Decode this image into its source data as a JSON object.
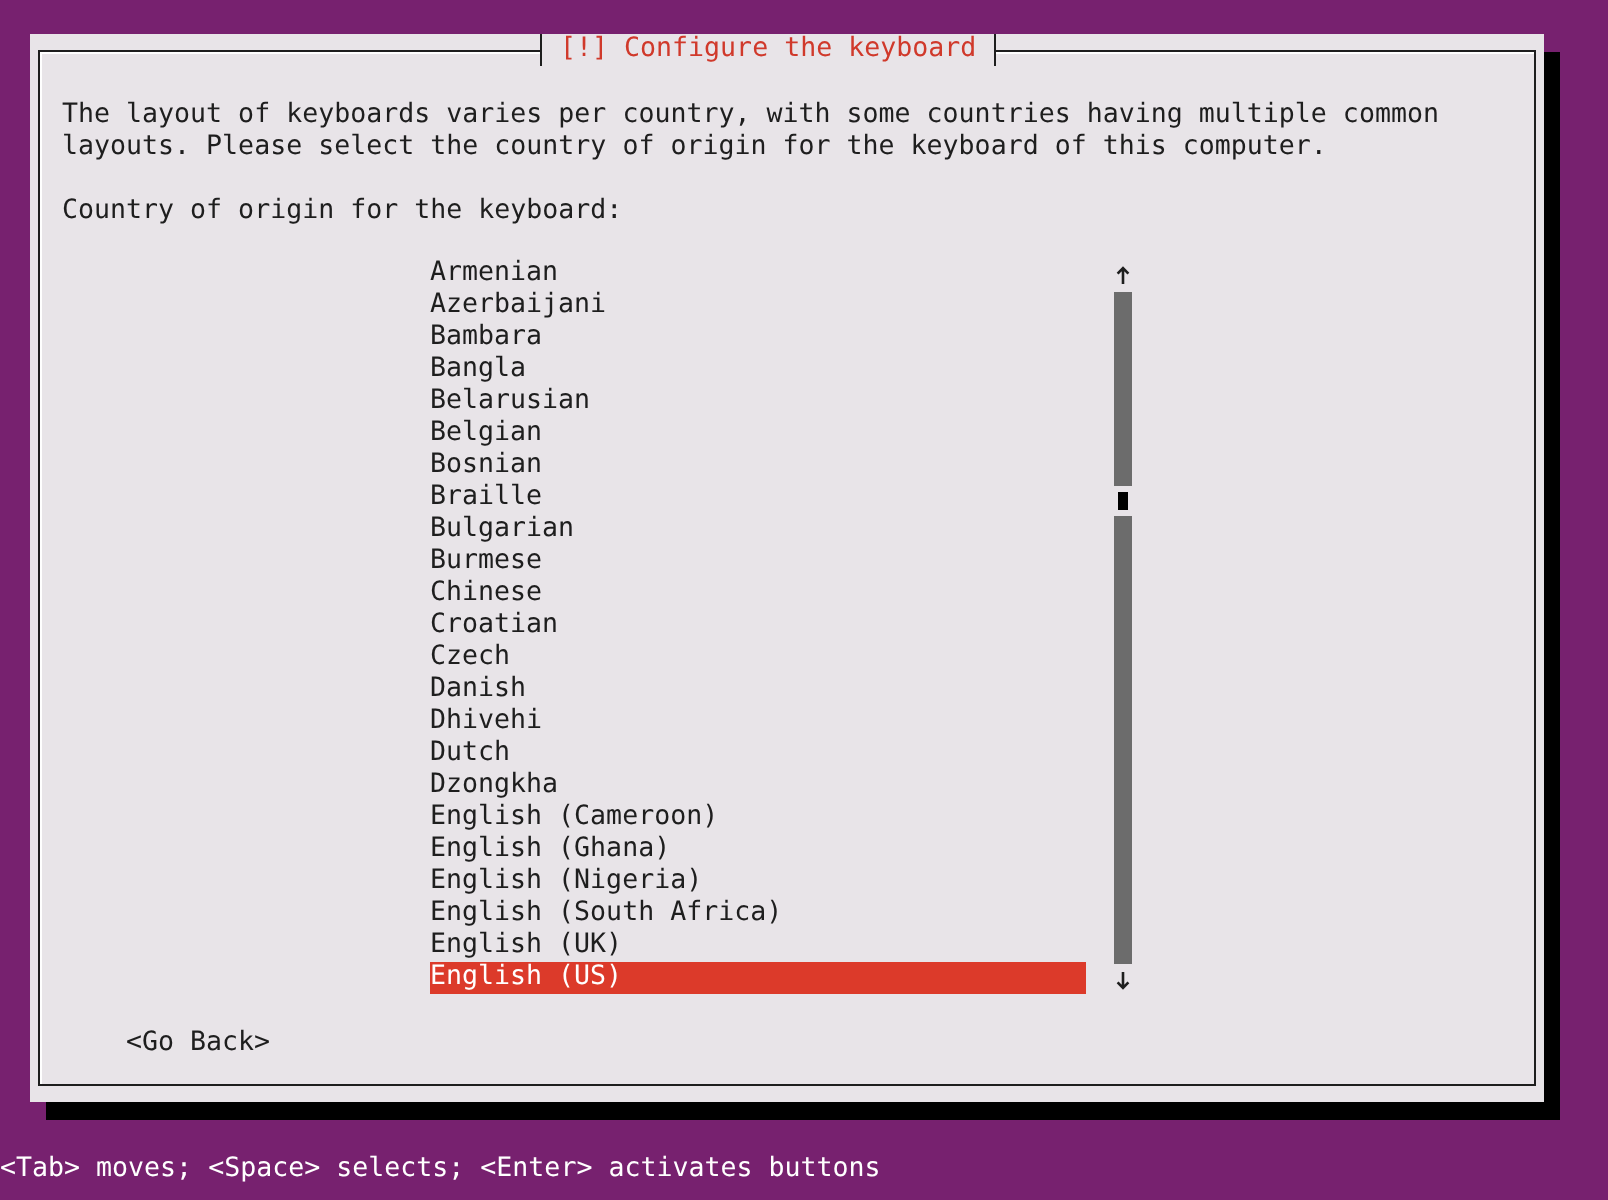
{
  "window": {
    "title": "[!] Configure the keyboard"
  },
  "description": "The layout of keyboards varies per country, with some countries having multiple common layouts. Please select the country of origin for the keyboard of this computer.",
  "prompt": "Country of origin for the keyboard:",
  "country_list": {
    "items": [
      {
        "label": "Armenian",
        "selected": false
      },
      {
        "label": "Azerbaijani",
        "selected": false
      },
      {
        "label": "Bambara",
        "selected": false
      },
      {
        "label": "Bangla",
        "selected": false
      },
      {
        "label": "Belarusian",
        "selected": false
      },
      {
        "label": "Belgian",
        "selected": false
      },
      {
        "label": "Bosnian",
        "selected": false
      },
      {
        "label": "Braille",
        "selected": false
      },
      {
        "label": "Bulgarian",
        "selected": false
      },
      {
        "label": "Burmese",
        "selected": false
      },
      {
        "label": "Chinese",
        "selected": false
      },
      {
        "label": "Croatian",
        "selected": false
      },
      {
        "label": "Czech",
        "selected": false
      },
      {
        "label": "Danish",
        "selected": false
      },
      {
        "label": "Dhivehi",
        "selected": false
      },
      {
        "label": "Dutch",
        "selected": false
      },
      {
        "label": "Dzongkha",
        "selected": false
      },
      {
        "label": "English (Cameroon)",
        "selected": false
      },
      {
        "label": "English (Ghana)",
        "selected": false
      },
      {
        "label": "English (Nigeria)",
        "selected": false
      },
      {
        "label": "English (South Africa)",
        "selected": false
      },
      {
        "label": "English (UK)",
        "selected": false
      },
      {
        "label": "English (US)",
        "selected": true
      }
    ]
  },
  "go_back_button": {
    "label": "<Go Back>"
  },
  "status_bar": "<Tab> moves; <Space> selects; <Enter> activates buttons"
}
